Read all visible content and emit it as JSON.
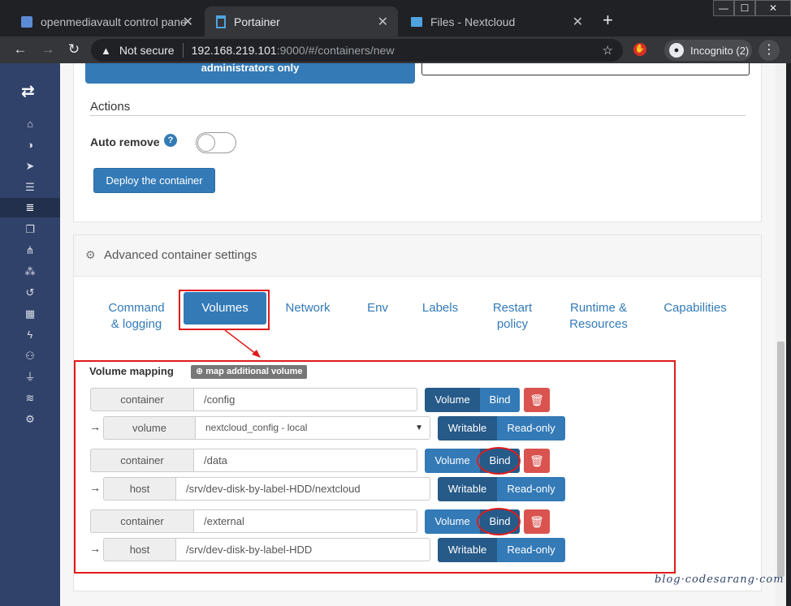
{
  "browser": {
    "tabs": [
      {
        "title": "openmediavault control panel - ",
        "close": "✕"
      },
      {
        "title": "Portainer",
        "close": "✕"
      },
      {
        "title": "Files - Nextcloud",
        "close": "✕"
      }
    ],
    "new_tab": "+",
    "window_controls": [
      "—",
      "☐",
      "✕"
    ],
    "address": {
      "security_label": "Not secure",
      "host": "192.168.219.101",
      "path": ":9000/#/containers/new"
    },
    "incognito_label": "Incognito (2)"
  },
  "sidebar": {
    "logo": "⇄",
    "items": [
      "⌂",
      "◑",
      "➤",
      "☰",
      "≣",
      "❐",
      "⋔",
      "⁂",
      "↺",
      "▦",
      "ϟ",
      "⚇",
      "⏚",
      "≋",
      "⚙"
    ]
  },
  "top_panel": {
    "admin_label": "administrators only",
    "actions_title": "Actions",
    "auto_remove_label": "Auto remove",
    "help": "?",
    "deploy_button": "Deploy the container"
  },
  "advanced": {
    "title": "Advanced container settings",
    "tabs": [
      {
        "label": "Command\n& logging"
      },
      {
        "label": "Volumes"
      },
      {
        "label": "Network"
      },
      {
        "label": "Env"
      },
      {
        "label": "Labels"
      },
      {
        "label": "Restart\npolicy"
      },
      {
        "label": "Runtime &\nResources"
      },
      {
        "label": "Capabilities"
      }
    ],
    "volume_mapping_title": "Volume mapping",
    "map_additional": "map additional volume",
    "mappings": [
      {
        "container_label": "container",
        "container_path": "/config",
        "type_volume": "Volume",
        "type_bind": "Bind",
        "source_label": "volume",
        "source_value": "nextcloud_config - local",
        "writable": "Writable",
        "readonly": "Read-only"
      },
      {
        "container_label": "container",
        "container_path": "/data",
        "type_volume": "Volume",
        "type_bind": "Bind",
        "source_label": "host",
        "source_value": "/srv/dev-disk-by-label-HDD/nextcloud",
        "writable": "Writable",
        "readonly": "Read-only"
      },
      {
        "container_label": "container",
        "container_path": "/external",
        "type_volume": "Volume",
        "type_bind": "Bind",
        "source_label": "host",
        "source_value": "/srv/dev-disk-by-label-HDD",
        "writable": "Writable",
        "readonly": "Read-only"
      }
    ]
  },
  "watermark": "blog·codesarang·com"
}
